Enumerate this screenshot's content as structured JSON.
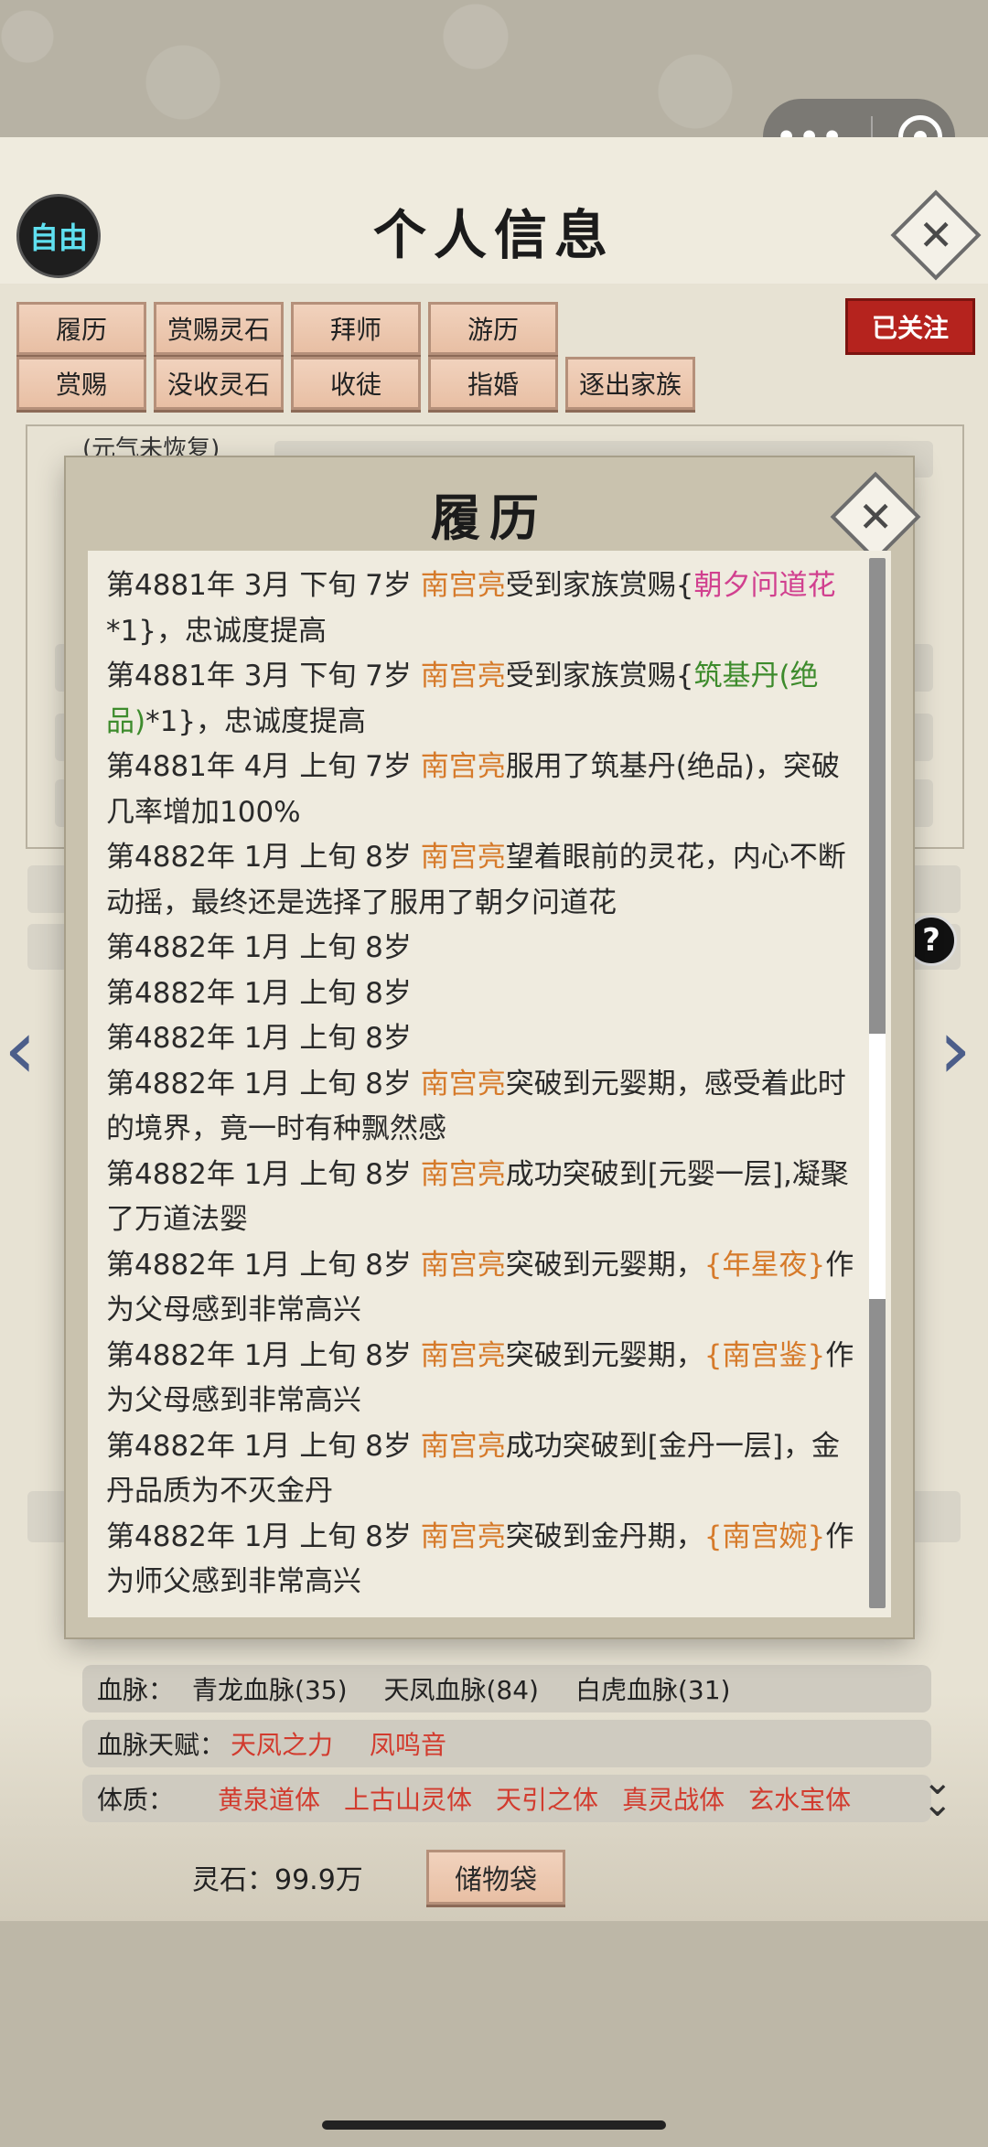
{
  "capsule": {
    "more": "•••"
  },
  "header": {
    "badge": "自由",
    "title": "个人信息"
  },
  "buttons": [
    {
      "label": "履历"
    },
    {
      "label": "赏赐灵石"
    },
    {
      "label": "拜师"
    },
    {
      "label": "游历"
    },
    {
      "label": "赏赐"
    },
    {
      "label": "没收灵石"
    },
    {
      "label": "收徒"
    },
    {
      "label": "指婚"
    },
    {
      "label": "逐出家族"
    }
  ],
  "follow_tag": "已关注",
  "status_note": "(元气未恢复)",
  "modal": {
    "title": "履历",
    "entries": [
      {
        "pre": "第4881年 3月 下旬 7岁 ",
        "name": "南宫亮",
        "mid": "受到家族赏赐{",
        "special": "朝夕问道花",
        "special_color": "pink",
        "post": "*1}，忠诚度提高"
      },
      {
        "pre": "第4881年 3月 下旬  7岁  ",
        "name": "南宫亮",
        "mid": "受到家族赏赐{",
        "special": "筑基丹(绝品)",
        "special_color": "green",
        "post": "*1}，忠诚度提高"
      },
      {
        "pre": "第4881年 4月 上旬 7岁  ",
        "name": "南宫亮",
        "mid": "服用了筑基丹(绝品)，突破几率增加100%",
        "special": "",
        "special_color": "",
        "post": ""
      },
      {
        "pre": "第4882年 1月 上旬 8岁 ",
        "name": "南宫亮",
        "mid": "望着眼前的灵花，内心不断动摇，最终还是选择了服用了朝夕问道花",
        "special": "",
        "special_color": "",
        "post": ""
      },
      {
        "pre": "第4882年 1月 上旬  8岁",
        "name": "",
        "mid": "",
        "special": "",
        "special_color": "",
        "post": ""
      },
      {
        "pre": "第4882年 1月 上旬  8岁",
        "name": "",
        "mid": "",
        "special": "",
        "special_color": "",
        "post": ""
      },
      {
        "pre": "第4882年 1月 上旬  8岁",
        "name": "",
        "mid": "",
        "special": "",
        "special_color": "",
        "post": ""
      },
      {
        "pre": "第4882年 1月 上旬 8岁 ",
        "name": "南宫亮",
        "mid": "突破到元婴期，感受着此时的境界，竟一时有种飘然感",
        "special": "",
        "special_color": "",
        "post": ""
      },
      {
        "pre": "第4882年  1月  上旬   8岁   ",
        "name": "南宫亮",
        "mid": "成功突破到[元婴一层],凝聚了万道法婴",
        "special": "",
        "special_color": "",
        "post": ""
      },
      {
        "pre": "第4882年  1月  上旬   8岁   ",
        "name": "南宫亮",
        "mid": "突破到元婴期，",
        "special": "{年星夜}",
        "special_color": "name",
        "post": "作为父母感到非常高兴"
      },
      {
        "pre": "第4882年  1月  上旬   8岁   ",
        "name": "南宫亮",
        "mid": "突破到元婴期，",
        "special": "{南宫鉴}",
        "special_color": "name",
        "post": "作为父母感到非常高兴"
      },
      {
        "pre": "第4882年  1月  上旬   8岁   ",
        "name": "南宫亮",
        "mid": "成功突破到[金丹一层]，金丹品质为不灭金丹",
        "special": "",
        "special_color": "",
        "post": ""
      },
      {
        "pre": "第4882年  1月  上旬   8岁   ",
        "name": "南宫亮",
        "mid": "突破到金丹期，",
        "special": "{南宫婉}",
        "special_color": "name",
        "post": "作为师父感到非常高兴"
      }
    ]
  },
  "bloodline": {
    "label": "血脉：",
    "items": [
      "青龙血脉(35)",
      "天凤血脉(84)",
      "白虎血脉(31)"
    ]
  },
  "bloodline_talent": {
    "label": "血脉天赋：",
    "items": [
      "天凤之力",
      "凤鸣音"
    ]
  },
  "physique": {
    "label": "体质：",
    "items": [
      "黄泉道体",
      "上古山灵体",
      "天引之体",
      "真灵战体",
      "玄水宝体"
    ]
  },
  "footer": {
    "spirit_stones": "灵石：99.9万",
    "bag": "储物袋"
  }
}
